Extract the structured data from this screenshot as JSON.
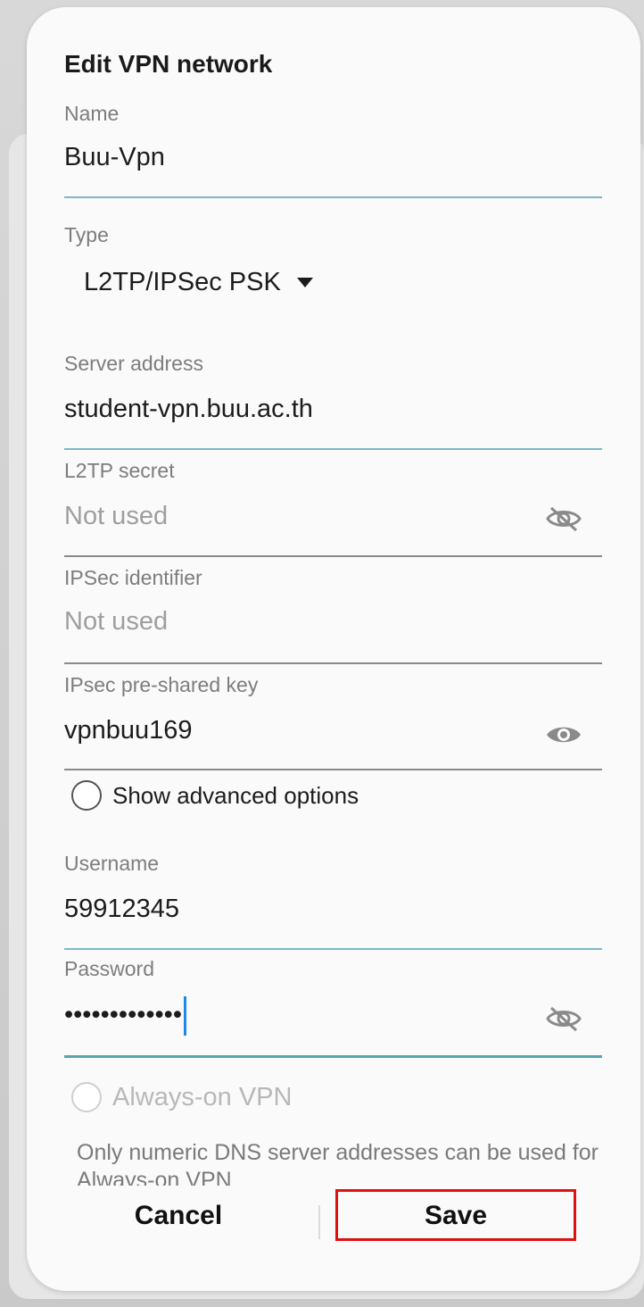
{
  "dialog": {
    "title": "Edit VPN network",
    "name": {
      "label": "Name",
      "value": "Buu-Vpn"
    },
    "type": {
      "label": "Type",
      "value": "L2TP/IPSec PSK"
    },
    "server": {
      "label": "Server address",
      "value": "student-vpn.buu.ac.th"
    },
    "l2tp_secret": {
      "label": "L2TP secret",
      "value": "Not used",
      "icon": "eye-off-icon"
    },
    "ipsec_identifier": {
      "label": "IPSec identifier",
      "value": "Not used"
    },
    "psk": {
      "label": "IPsec pre-shared key",
      "value": "vpnbuu169",
      "icon": "eye-icon"
    },
    "advanced": {
      "label": "Show advanced options",
      "checked": false
    },
    "username": {
      "label": "Username",
      "value": "59912345"
    },
    "password": {
      "label": "Password",
      "value": "•••••••••••••",
      "icon": "eye-off-icon"
    },
    "always_on": {
      "label": "Always-on VPN",
      "enabled": false
    },
    "note": "Only numeric DNS server addresses can be used for Always-on VPN",
    "cancel_label": "Cancel",
    "save_label": "Save"
  },
  "colors": {
    "accent_line": "#7cb8c3",
    "highlight": "#e01010",
    "cursor": "#1e88e5"
  }
}
